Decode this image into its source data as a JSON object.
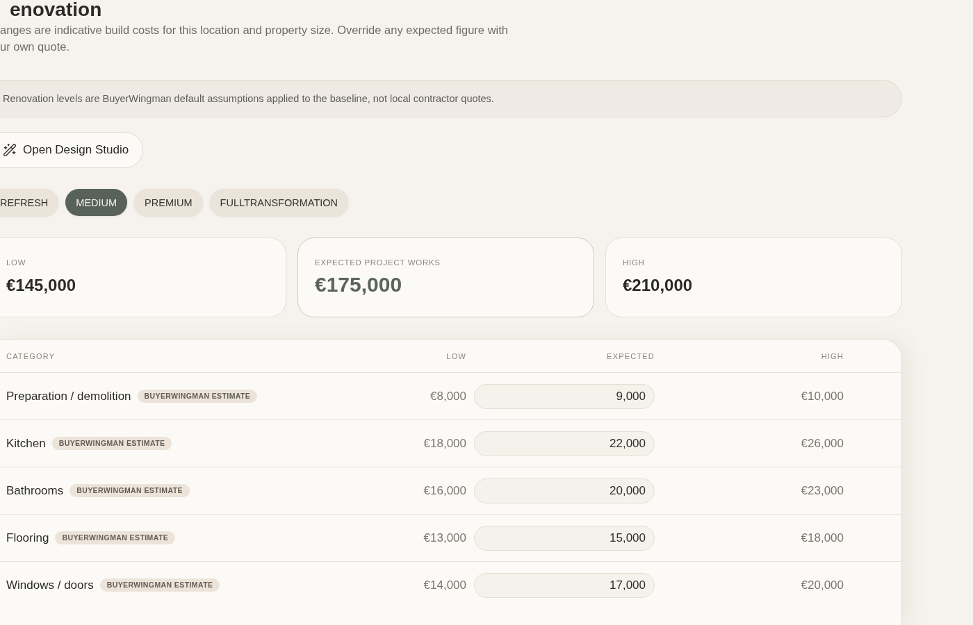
{
  "page": {
    "title": "enovation",
    "description_lines": [
      "anges are indicative build costs for this location and property size. Override any expected figure with",
      "ur own quote."
    ]
  },
  "notice": {
    "text": "Renovation levels are BuyerWingman default assumptions applied to the baseline, not local contractor quotes."
  },
  "design_button": {
    "label": "Open Design Studio"
  },
  "levels": [
    {
      "label": "REFRESH",
      "selected": false
    },
    {
      "label": "MEDIUM",
      "selected": true
    },
    {
      "label": "PREMIUM",
      "selected": false
    },
    {
      "label": "FULLTRANSFORMATION",
      "selected": false
    }
  ],
  "summary_cards": [
    {
      "kind": "range",
      "label": "LOW",
      "value": "€145,000"
    },
    {
      "kind": "expected",
      "label": "EXPECTED PROJECT WORKS",
      "value": "€175,000"
    },
    {
      "kind": "range",
      "label": "HIGH",
      "value": "€210,000"
    }
  ],
  "table": {
    "columns": [
      "CATEGORY",
      "LOW",
      "EXPECTED",
      "HIGH"
    ],
    "rows": [
      {
        "category": "Preparation / demolition",
        "badge": "BUYERWINGMAN ESTIMATE",
        "low": "€8,000",
        "expected": "9,000",
        "high": "€10,000"
      },
      {
        "category": "Kitchen",
        "badge": "BUYERWINGMAN ESTIMATE",
        "low": "€18,000",
        "expected": "22,000",
        "high": "€26,000"
      },
      {
        "category": "Bathrooms",
        "badge": "BUYERWINGMAN ESTIMATE",
        "low": "€16,000",
        "expected": "20,000",
        "high": "€23,000"
      },
      {
        "category": "Flooring",
        "badge": "BUYERWINGMAN ESTIMATE",
        "low": "€13,000",
        "expected": "15,000",
        "high": "€18,000"
      },
      {
        "category": "Windows / doors",
        "badge": "BUYERWINGMAN ESTIMATE",
        "low": "€14,000",
        "expected": "17,000",
        "high": "€20,000"
      }
    ]
  }
}
